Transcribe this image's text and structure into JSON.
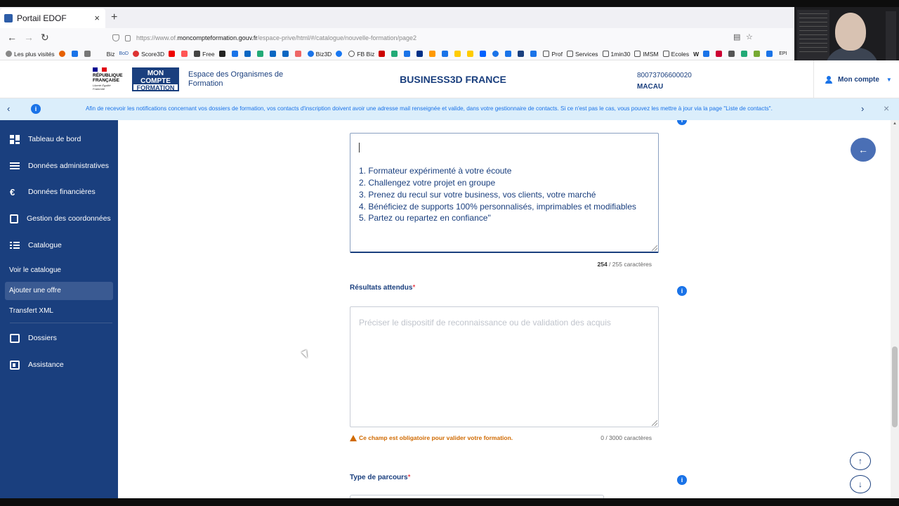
{
  "browser": {
    "tab_title": "Portail EDOF",
    "tab_close": "×",
    "new_tab": "+",
    "url_prefix": "https://www.of.",
    "url_domain": "moncompteformation.gouv.fr",
    "url_path": "/espace-prive/html/#/catalogue/nouvelle-formation/page2",
    "bookmarks": [
      "Les plus visités",
      "Biz",
      "BoD",
      "Score3D",
      "Free",
      "Biz3D",
      "FB Biz",
      "Prof",
      "Services",
      "1min30",
      "IMSM",
      "Ecoles",
      "W",
      "EPI"
    ]
  },
  "header": {
    "republique": "RÉPUBLIQUE FRANÇAISE",
    "devise": "Liberté Égalité Fraternité",
    "logo_line1": "MON COMPTE",
    "logo_line2": "FORMATION",
    "espace": "Espace des Organismes de Formation",
    "brand": "BUSINESS3D FRANCE",
    "siret": "80073706600020",
    "city": "MACAU",
    "account": "Mon compte"
  },
  "notice": {
    "message": "Afin de recevoir les notifications concernant vos dossiers de formation, vos contacts d'inscription doivent avoir une adresse mail renseignée et valide, dans votre gestionnaire de contacts. Si ce n'est pas le cas, vous pouvez les mettre à jour via la page \"Liste de contacts\"."
  },
  "sidebar": {
    "items": [
      {
        "label": "Tableau de bord"
      },
      {
        "label": "Données administratives"
      },
      {
        "label": "Données financières"
      },
      {
        "label": "Gestion des coordonnées"
      },
      {
        "label": "Catalogue"
      },
      {
        "label": "Voir le catalogue"
      },
      {
        "label": "Ajouter une offre"
      },
      {
        "label": "Transfert XML"
      },
      {
        "label": "Dossiers"
      },
      {
        "label": "Assistance"
      }
    ]
  },
  "form": {
    "points_forts_value": "1. Formateur expérimenté à votre écoute\n2. Challengez votre projet en groupe\n3. Prenez du recul sur votre business, vos clients, votre marché\n4. Bénéficiez de supports 100% personnalisés, imprimables et modifiables\n5. Partez ou repartez en confiance\"",
    "points_forts_count": "254",
    "points_forts_count_suffix": " / 255 caractères",
    "resultats_label": "Résultats attendus",
    "required_mark": "*",
    "resultats_placeholder": "Préciser le dispositif de reconnaissance ou de validation des acquis",
    "resultats_warning": "Ce champ est obligatoire pour valider votre formation.",
    "resultats_count": "0 / 3000 caractères",
    "parcours_label": "Type de parcours"
  },
  "icons": {
    "info": "i",
    "back": "←",
    "up": "↑",
    "down": "↓",
    "prev": "‹",
    "next": "›",
    "close": "×"
  }
}
